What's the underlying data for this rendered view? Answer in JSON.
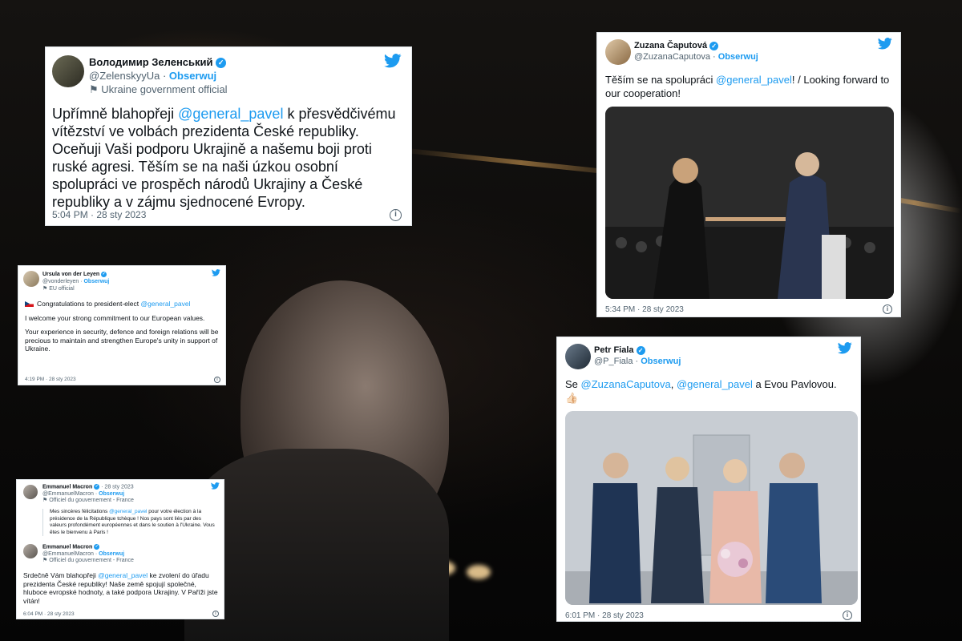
{
  "tweets": {
    "zelensky": {
      "name": "Володимир Зеленський",
      "handle": "@ZelenskyyUa",
      "follow": "Obserwuj",
      "label": "Ukraine government official",
      "text_a": "Upřímně blahopřeji ",
      "mention": "@general_pavel",
      "text_b": " k přesvědčivému vítězství ve volbách prezidenta České republiky. Oceňuji Vaši podporu Ukrajině a našemu boji proti ruské agresi. Těším se na naši úzkou osobní spolupráci ve prospěch národů Ukrajiny a České republiky a v zájmu sjednocené Evropy.",
      "time": "5:04 PM · 28 sty 2023"
    },
    "caputova": {
      "name": "Zuzana Čaputová",
      "handle": "@ZuzanaCaputova",
      "follow": "Obserwuj",
      "text_a": "Těším se na spolupráci ",
      "mention": "@general_pavel",
      "text_b": "! / Looking forward to our cooperation!",
      "time": "5:34 PM · 28 sty 2023"
    },
    "vonderleyen": {
      "name": "Ursula von der Leyen",
      "handle": "@vonderleyen",
      "follow": "Obserwuj",
      "label": "EU official",
      "p1_a": "Congratulations to president-elect ",
      "mention": "@general_pavel",
      "p2": "I welcome your strong commitment to our European values.",
      "p3": "Your experience in security, defence and foreign relations will be precious to maintain and strengthen Europe's unity in support of Ukraine.",
      "time": "4:19 PM · 28 sty 2023"
    },
    "macron_quote": {
      "name": "Emmanuel Macron",
      "date": "· 28 sty 2023",
      "handle": "@EmmanuelMacron",
      "follow": "Obserwuj",
      "label": "Officiel du gouvernement - France",
      "text_a": "Mes sincères félicitations ",
      "mention": "@general_pavel",
      "text_b": " pour votre élection à la présidence de la République tchèque ! Nos pays sont liés par des valeurs profondément européennes et dans le soutien à l'Ukraine. Vous êtes le bienvenu à Paris !"
    },
    "macron": {
      "name": "Emmanuel Macron",
      "handle": "@EmmanuelMacron",
      "follow": "Obserwuj",
      "label": "Officiel du gouvernement - France",
      "text_a": "Srdečně Vám blahopřeji ",
      "mention": "@general_pavel",
      "text_b": " ke zvolení do úřadu prezidenta České republiky! Naše země spojují společné, hluboce evropské hodnoty, a také podpora Ukrajiny. V Paříži jste vítán!",
      "time": "6:04 PM · 28 sty 2023"
    },
    "fiala": {
      "name": "Petr Fiala",
      "handle": "@P_Fiala",
      "follow": "Obserwuj",
      "text_a": "Se ",
      "mention_1": "@ZuzanaCaputova",
      "text_b": ", ",
      "mention_2": "@general_pavel",
      "text_c": " a Evou Pavlovou.",
      "emoji": "👍🏻",
      "time": "6:01 PM · 28 sty 2023"
    }
  },
  "sep": " · ",
  "icons": {
    "bird": "twitter-bird-icon",
    "verified": "verified-badge-icon",
    "info": "info-icon",
    "flag": "government-flag-icon"
  },
  "colors": {
    "accent": "#1d9bf0",
    "muted": "#536471"
  }
}
